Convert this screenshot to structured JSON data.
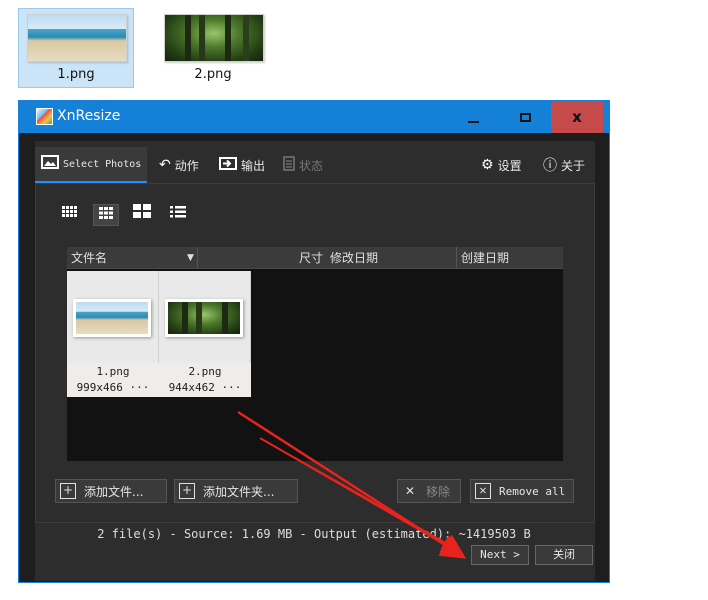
{
  "desktop": {
    "files": [
      {
        "label": "1.png",
        "selected": true
      },
      {
        "label": "2.png",
        "selected": false
      }
    ]
  },
  "window": {
    "title": "XnResize",
    "controls": {
      "minimize": "minimize-icon",
      "maximize": "maximize-icon",
      "close": "x"
    }
  },
  "tabs": [
    {
      "label": "Select Photos",
      "icon": "photo-icon",
      "active": true
    },
    {
      "label": "动作",
      "icon": "undo-arrow-icon"
    },
    {
      "label": "输出",
      "icon": "output-icon"
    },
    {
      "label": "状态",
      "icon": "document-icon",
      "disabled": true
    }
  ],
  "header_right": {
    "settings_label": "设置",
    "about_label": "关于"
  },
  "view_modes": [
    "small-grid-icon",
    "medium-grid-icon",
    "large-grid-icon",
    "list-icon"
  ],
  "table": {
    "columns": [
      "文件名",
      "尺寸",
      "修改日期",
      "创建日期"
    ],
    "files": [
      {
        "name": "1.png",
        "dims": "999x466 ···"
      },
      {
        "name": "2.png",
        "dims": "944x462 ···"
      }
    ]
  },
  "buttons": {
    "add_files": "添加文件...",
    "add_folder": "添加文件夹...",
    "remove": "移除",
    "remove_all": "Remove all"
  },
  "status": "2 file(s) - Source: 1.69 MB - Output (estimated): ~1419503 B",
  "footer": {
    "next": "Next >",
    "close": "关闭"
  },
  "colors": {
    "titlebar": "#1480d8",
    "annotation_arrow": "#e8231e"
  }
}
